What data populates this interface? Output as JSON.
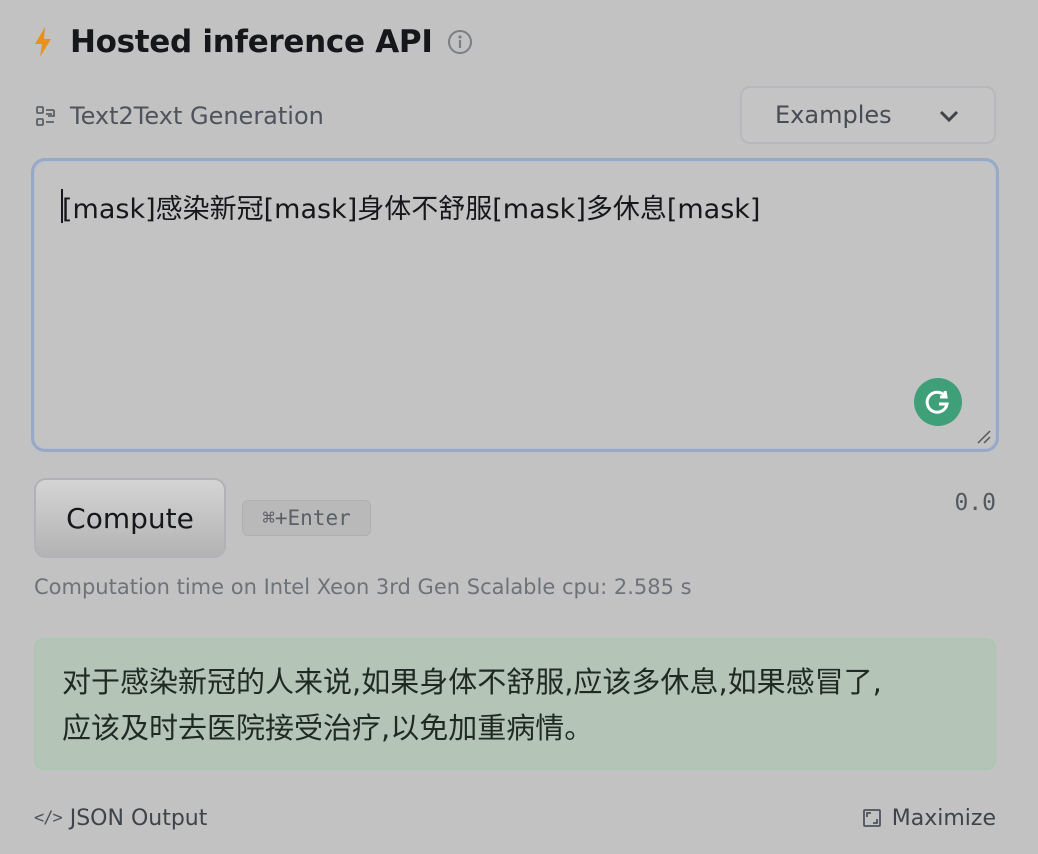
{
  "header": {
    "title": "Hosted inference API",
    "icon": "lightning-bolt-icon",
    "accent": "#e8911c"
  },
  "task": {
    "label": "Text2Text Generation",
    "icon": "text2text-task-icon"
  },
  "examples": {
    "label": "Examples"
  },
  "input": {
    "value": "[mask]感染新冠[mask]身体不舒服[mask]多休息[mask]"
  },
  "actions": {
    "compute_label": "Compute",
    "shortcut": "⌘+Enter",
    "score": "0.0"
  },
  "status": {
    "computation_time": "Computation time on Intel Xeon 3rd Gen Scalable cpu: 2.585 s"
  },
  "output": {
    "lines": [
      "对于感染新冠的人来说,如果身体不舒服,应该多休息,如果感冒了,",
      "应该及时去医院接受治疗,以免加重病情。"
    ]
  },
  "footer": {
    "json_label": "JSON Output",
    "maximize_label": "Maximize",
    "code_glyph": "</>"
  }
}
